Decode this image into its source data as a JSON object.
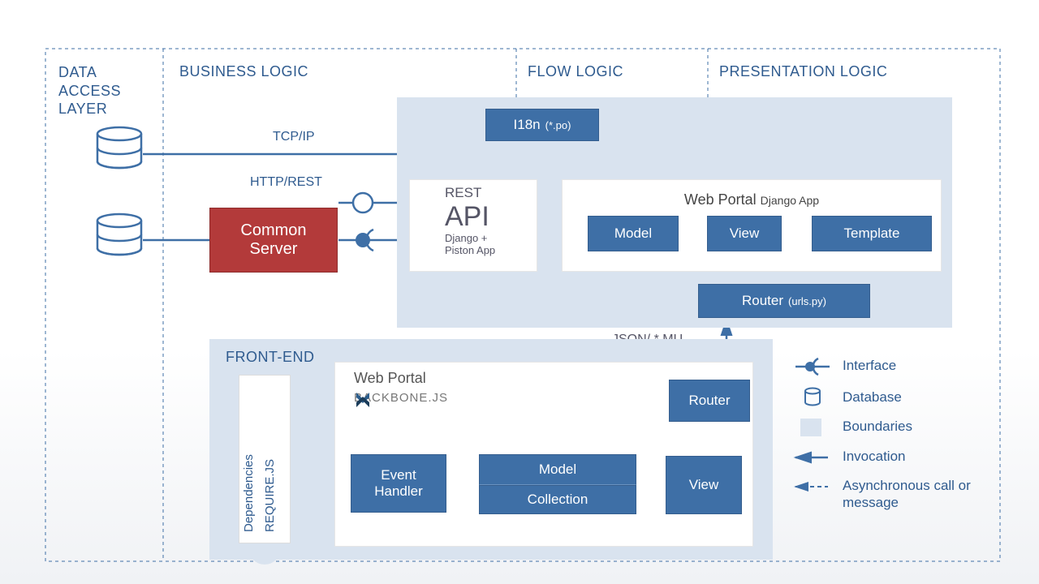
{
  "layers": {
    "data_access": "DATA ACCESS LAYER",
    "business_logic": "BUSINESS LOGIC",
    "flow_logic": "FLOW LOGIC",
    "presentation_logic": "PRESENTATION LOGIC",
    "front_end": "FRONT-END"
  },
  "boxes": {
    "common_server_line1": "Common",
    "common_server_line2": "Server",
    "i18n": "I18n",
    "i18n_sub": "(*.po)",
    "rest": "REST",
    "api": "API",
    "api_sub1": "Django +",
    "api_sub2": "Piston App",
    "web_portal": "Web Portal",
    "django_app": "Django App",
    "model": "Model",
    "view": "View",
    "template": "Template",
    "router": "Router",
    "router_sub": "(urls.py)",
    "web_portal2": "Web Portal",
    "backbone": "BACKBONE.JS",
    "event_handler_l1": "Event",
    "event_handler_l2": "Handler",
    "fe_model": "Model",
    "fe_collection": "Collection",
    "fe_view": "View",
    "fe_router": "Router"
  },
  "labels": {
    "tcp_ip": "TCP/IP",
    "http_rest": "HTTP/REST",
    "json_mu": "JSON/ *.MU",
    "dependencies": "Dependencies",
    "require_js": "REQUIRE.JS"
  },
  "legend": {
    "interface": "Interface",
    "database": "Database",
    "boundaries": "Boundaries",
    "invocation": "Invocation",
    "async": "Asynchronous call or message"
  },
  "colors": {
    "blue": "#3e6fa6",
    "light_blue": "#d9e3ef",
    "red": "#b33a3a",
    "text_blue": "#2f5b8f"
  }
}
